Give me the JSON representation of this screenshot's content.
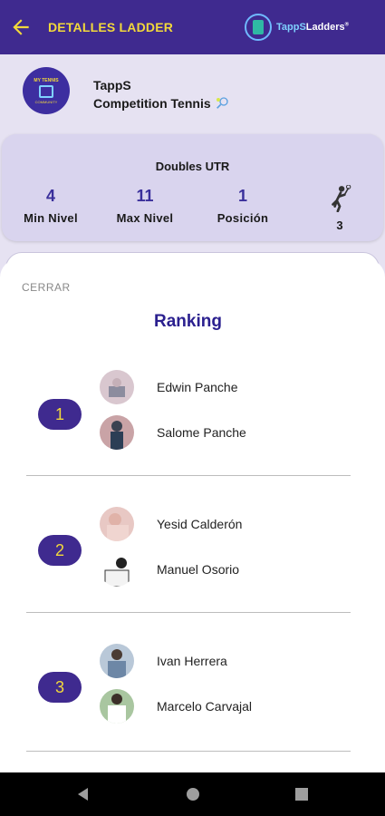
{
  "appbar": {
    "title": "DETALLES LADDER",
    "brand_prefix": "TappS",
    "brand_suffix": "Ladders",
    "back_icon": "arrow-left-icon"
  },
  "club": {
    "name": "TappS",
    "subtitle": "Competition Tennis",
    "logo_text_top": "MY TENNIS",
    "logo_text_bottom": "COMMUNITY"
  },
  "stats": {
    "title": "Doubles UTR",
    "min_value": "4",
    "min_label": "Min Nivel",
    "max_value": "11",
    "max_label": "Max Nivel",
    "pos_value": "1",
    "pos_label": "Posición",
    "players_count": "3"
  },
  "sheet": {
    "close_label": "CERRAR",
    "title": "Ranking",
    "rankings": [
      {
        "rank": "1",
        "player1": "Edwin Panche",
        "player2": "Salome Panche"
      },
      {
        "rank": "2",
        "player1": "Yesid Calderón",
        "player2": "Manuel  Osorio"
      },
      {
        "rank": "3",
        "player1": "Ivan Herrera",
        "player2": "Marcelo Carvajal"
      }
    ]
  },
  "colors": {
    "primary": "#3f2a8f",
    "accent": "#f2d83b",
    "background": "#e6e2f2"
  }
}
